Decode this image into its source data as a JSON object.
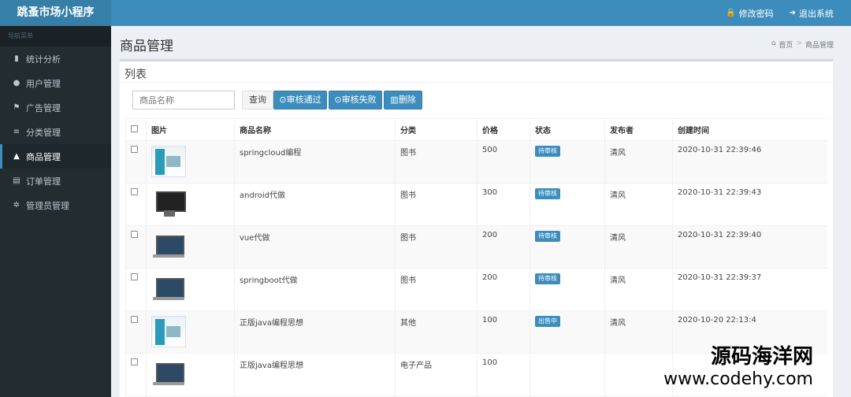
{
  "app": {
    "title": "跳蚤市场小程序"
  },
  "topbar": {
    "change_password": "修改密码",
    "logout": "退出系统"
  },
  "sidebar": {
    "header": "导航菜单",
    "items": [
      {
        "label": "统计分析",
        "icon": "bar-chart-icon"
      },
      {
        "label": "用户管理",
        "icon": "user-icon"
      },
      {
        "label": "广告管理",
        "icon": "flag-icon"
      },
      {
        "label": "分类管理",
        "icon": "list-icon"
      },
      {
        "label": "商品管理",
        "icon": "bank-icon",
        "active": true
      },
      {
        "label": "订单管理",
        "icon": "file-icon"
      },
      {
        "label": "管理员管理",
        "icon": "gear-icon"
      }
    ]
  },
  "page": {
    "title": "商品管理",
    "breadcrumb": [
      "首页",
      "商品管理"
    ]
  },
  "box": {
    "title": "列表"
  },
  "toolbar": {
    "search_placeholder": "商品名称",
    "query_label": "查询",
    "approve_label": "审核通过",
    "reject_label": "审核失败",
    "delete_label": "删除"
  },
  "table": {
    "headers": [
      "",
      "图片",
      "商品名称",
      "分类",
      "价格",
      "状态",
      "发布者",
      "创建时间"
    ],
    "rows": [
      {
        "thumb": "book",
        "name": "springcloud编程",
        "category": "图书",
        "price": "500",
        "status": "待审核",
        "publisher": "清风",
        "created": "2020-10-31 22:39:46"
      },
      {
        "thumb": "desktop",
        "name": "android代做",
        "category": "图书",
        "price": "300",
        "status": "待审核",
        "publisher": "清风",
        "created": "2020-10-31 22:39:43"
      },
      {
        "thumb": "laptop",
        "name": "vue代做",
        "category": "图书",
        "price": "200",
        "status": "待审核",
        "publisher": "清风",
        "created": "2020-10-31 22:39:40"
      },
      {
        "thumb": "laptop",
        "name": "springboot代做",
        "category": "图书",
        "price": "200",
        "status": "待审核",
        "publisher": "清风",
        "created": "2020-10-31 22:39:37"
      },
      {
        "thumb": "book",
        "name": "正版java编程思想",
        "category": "其他",
        "price": "100",
        "status": "出售中",
        "publisher": "清风",
        "created": "2020-10-20 22:13:4"
      },
      {
        "thumb": "laptop",
        "name": "正版java编程思想",
        "category": "电子产品",
        "price": "100",
        "status": "",
        "publisher": "",
        "created": ""
      }
    ]
  },
  "watermark": {
    "cn": "源码海洋网",
    "url": "www.codehy.com"
  },
  "colors": {
    "accent": "#3c8dbc",
    "sidebar": "#222d32"
  }
}
